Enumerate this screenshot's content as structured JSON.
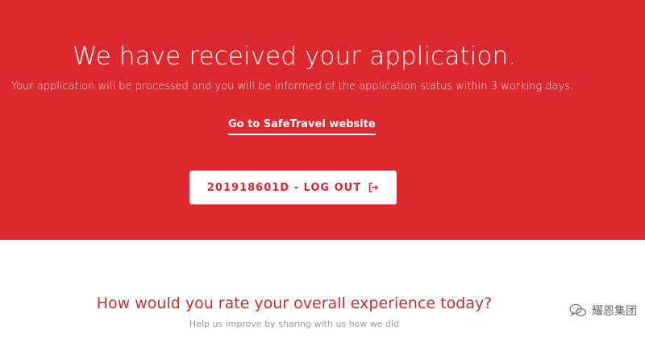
{
  "confirmation": {
    "title": "We have received your application.",
    "subtitle": "Your application will be processed and you will be informed of the application status within 3 working days.",
    "website_link_label": "Go to SafeTravel website",
    "logout_button_label": "201918601D - LOG OUT",
    "logout_icon": "logout-icon"
  },
  "feedback": {
    "question": "How would you rate your overall experience today?",
    "hint": "Help us improve by sharing with us how we did"
  },
  "watermark": {
    "text": "耀恩集团",
    "icon": "wechat-icon"
  },
  "colors": {
    "hero_background": "#dd282f",
    "accent_red": "#cc2d2d",
    "hint_gray": "#9a9a9a",
    "white": "#ffffff"
  }
}
